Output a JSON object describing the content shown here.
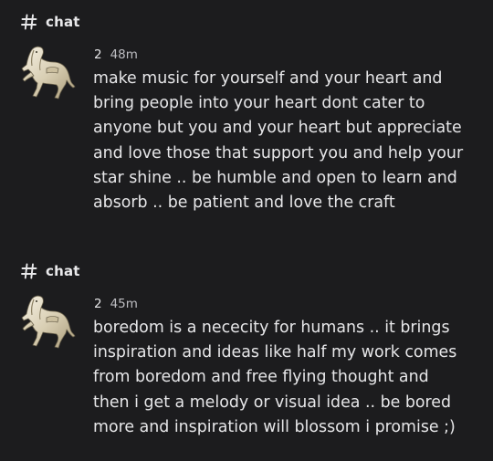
{
  "posts": [
    {
      "channel": "chat",
      "author": "2",
      "time": "48m",
      "avatar_icon": "horse-icon",
      "lines": [
        "make music for yourself and your heart and",
        "bring people into your heart dont cater to",
        "anyone but you and your heart but appreciate",
        "and love those that support you and help your",
        "star shine .. be humble and open to learn and",
        "absorb .. be patient and love the craft"
      ]
    },
    {
      "channel": "chat",
      "author": "2",
      "time": "45m",
      "avatar_icon": "horse-icon",
      "lines": [
        "boredom is a nececity for humans .. it brings",
        "inspiration and ideas like half my work comes",
        "from boredom and free flying thought and",
        "then i get a melody or visual idea .. be bored",
        "more and inspiration will blossom i promise ;)"
      ]
    }
  ],
  "colors": {
    "background": "#1c1c1e",
    "text": "#e6e6e8",
    "timestamp": "#bdbdc2"
  }
}
